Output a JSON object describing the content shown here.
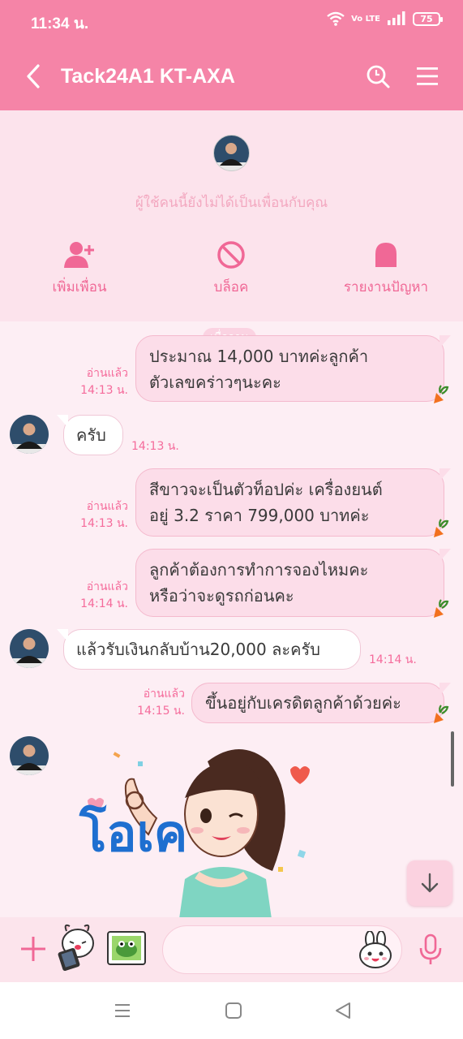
{
  "status": {
    "time": "11:34 น.",
    "signal_text": "Vo LTE",
    "battery": "75"
  },
  "header": {
    "title": "Tack24A1 KT-AXA"
  },
  "notice": {
    "text": "ผู้ใช้คนนี้ยังไม่ได้เป็นเพื่อนกับคุณ",
    "add_friend": "เพิ่มเพื่อน",
    "block": "บล็อค",
    "report": "รายงานปัญหา"
  },
  "chat": {
    "date_separator": "เมื่อวาน",
    "messages": [
      {
        "dir": "out",
        "lines": [
          "ประมาณ 14,000 บาทค่ะลูกค้า",
          "ตัวเลขคร่าวๆนะคะ"
        ],
        "read": "อ่านแล้ว",
        "time": "14:13 น."
      },
      {
        "dir": "in",
        "lines": [
          "ครับ"
        ],
        "time": "14:13 น."
      },
      {
        "dir": "out",
        "lines": [
          "สีขาวจะเป็นตัวท็อปค่ะ เครื่องยนต์",
          "อยู่ 3.2 ราคา 799,000 บาทค่ะ"
        ],
        "read": "อ่านแล้ว",
        "time": "14:13 น."
      },
      {
        "dir": "out",
        "lines": [
          "ลูกค้าต้องการทำการจองไหมคะ",
          "หรือว่าจะดูรถก่อนคะ"
        ],
        "read": "อ่านแล้ว",
        "time": "14:14 น."
      },
      {
        "dir": "in",
        "lines": [
          "แล้วรับเงินกลับบ้าน20,000 ละครับ"
        ],
        "time": "14:14 น."
      },
      {
        "dir": "out",
        "lines": [
          "ขึ้นอยู่กับเครดิตลูกค้าด้วยค่ะ"
        ],
        "read": "อ่านแล้ว",
        "time": "14:15 น."
      }
    ],
    "sticker_text": "โอเค"
  },
  "colors": {
    "brand": "#f584a7",
    "accent": "#f06896",
    "read_meta": "#f56b9b",
    "bubble_out": "#fcdde9"
  },
  "icons": {
    "back": "chevron-left-icon",
    "search": "search-icon",
    "menu": "hamburger-icon",
    "add": "plus-icon",
    "mic": "microphone-icon",
    "scroll_down": "arrow-down-icon"
  }
}
